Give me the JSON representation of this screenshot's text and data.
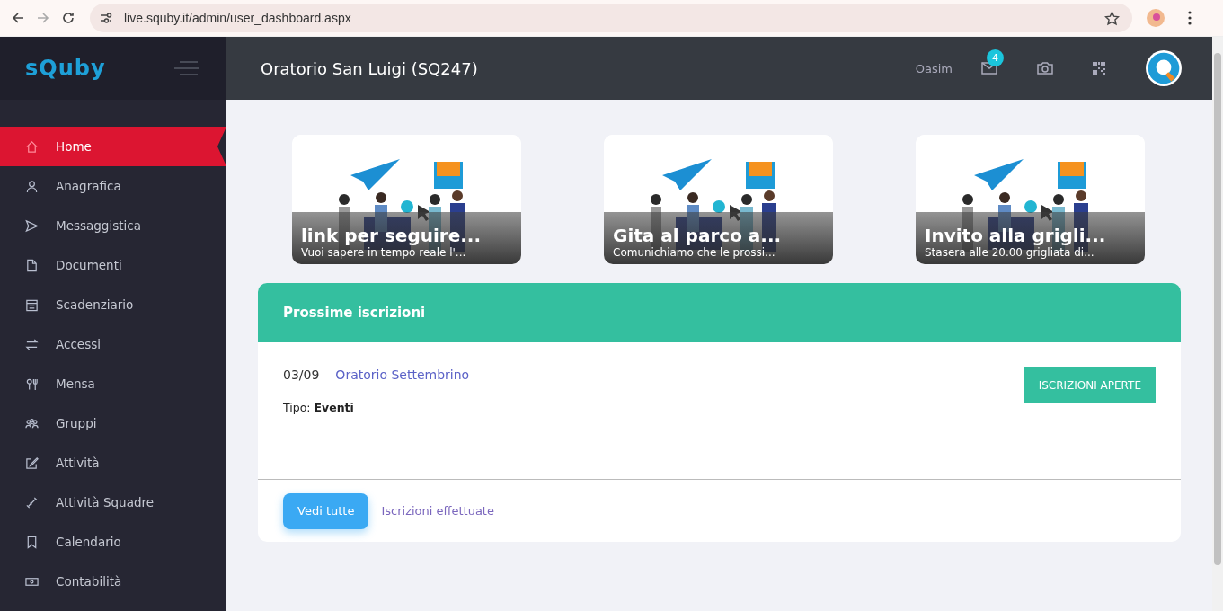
{
  "browser": {
    "url": "live.squby.it/admin/user_dashboard.aspx"
  },
  "header": {
    "logo": "sQuby",
    "title": "Oratorio San Luigi (SQ247)",
    "user": "Oasim",
    "mail_count": "4"
  },
  "sidebar": {
    "items": [
      {
        "label": "Home",
        "selected": true
      },
      {
        "label": "Anagrafica",
        "selected": false
      },
      {
        "label": "Messaggistica",
        "selected": false
      },
      {
        "label": "Documenti",
        "selected": false
      },
      {
        "label": "Scadenziario",
        "selected": false
      },
      {
        "label": "Accessi",
        "selected": false
      },
      {
        "label": "Mensa",
        "selected": false
      },
      {
        "label": "Gruppi",
        "selected": false
      },
      {
        "label": "Attività",
        "selected": false
      },
      {
        "label": "Attività Squadre",
        "selected": false
      },
      {
        "label": "Calendario",
        "selected": false
      },
      {
        "label": "Contabilità",
        "selected": false
      }
    ]
  },
  "news": [
    {
      "title": "link per seguire...",
      "text": "Vuoi sapere in tempo reale l'..."
    },
    {
      "title": "Gita al parco a...",
      "text": "Comunichiamo che le prossi..."
    },
    {
      "title": "Invito alla grigli...",
      "text": "Stasera alle 20.00 grigliata di..."
    }
  ],
  "registrations": {
    "title": "Prossime iscrizioni",
    "items": [
      {
        "date": "03/09",
        "name": "Oratorio Settembrino",
        "type_label": "Tipo:",
        "type": "Eventi",
        "status": "ISCRIZIONI APERTE"
      }
    ],
    "button": "Vedi tutte",
    "link": "Iscrizioni effettuate"
  }
}
